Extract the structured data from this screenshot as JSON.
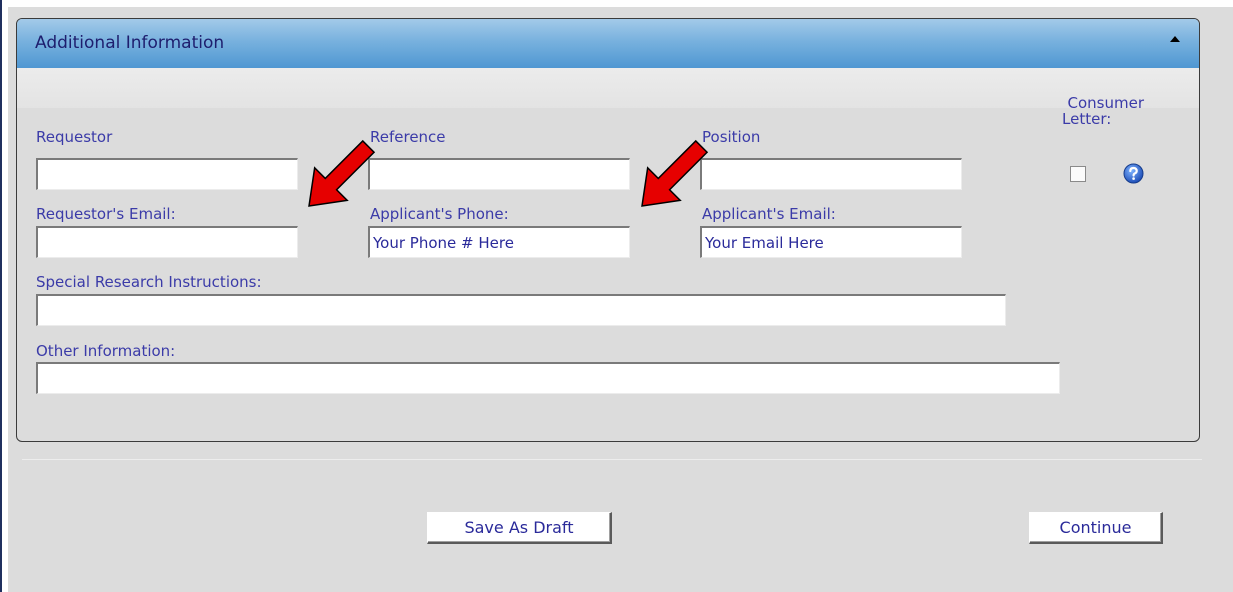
{
  "panel": {
    "title": "Additional Information"
  },
  "fields": {
    "requestor": {
      "label": "Requestor",
      "value": ""
    },
    "reference": {
      "label": "Reference",
      "value": ""
    },
    "position": {
      "label": "Position",
      "value": ""
    },
    "requestor_email": {
      "label": "Requestor's Email:",
      "value": ""
    },
    "applicant_phone": {
      "label": "Applicant's Phone:",
      "value": "Your Phone # Here"
    },
    "applicant_email": {
      "label": "Applicant's Email:",
      "value": "Your Email Here"
    },
    "special_instructions": {
      "label": "Special Research Instructions:",
      "value": ""
    },
    "other_info": {
      "label": "Other Information:",
      "value": ""
    }
  },
  "consumer_letter": {
    "label_line1": "Consumer",
    "label_line2": "Letter:",
    "checked": false
  },
  "buttons": {
    "save_draft": "Save As Draft",
    "continue": "Continue"
  },
  "icons": {
    "collapse": "collapse-up-icon",
    "help": "help-icon",
    "arrow": "red-arrow-icon"
  },
  "colors": {
    "header_gradient_top": "#a3cae9",
    "header_gradient_bottom": "#4f97d2",
    "label_text": "#3b3ba8",
    "arrow_red": "#e60000"
  }
}
